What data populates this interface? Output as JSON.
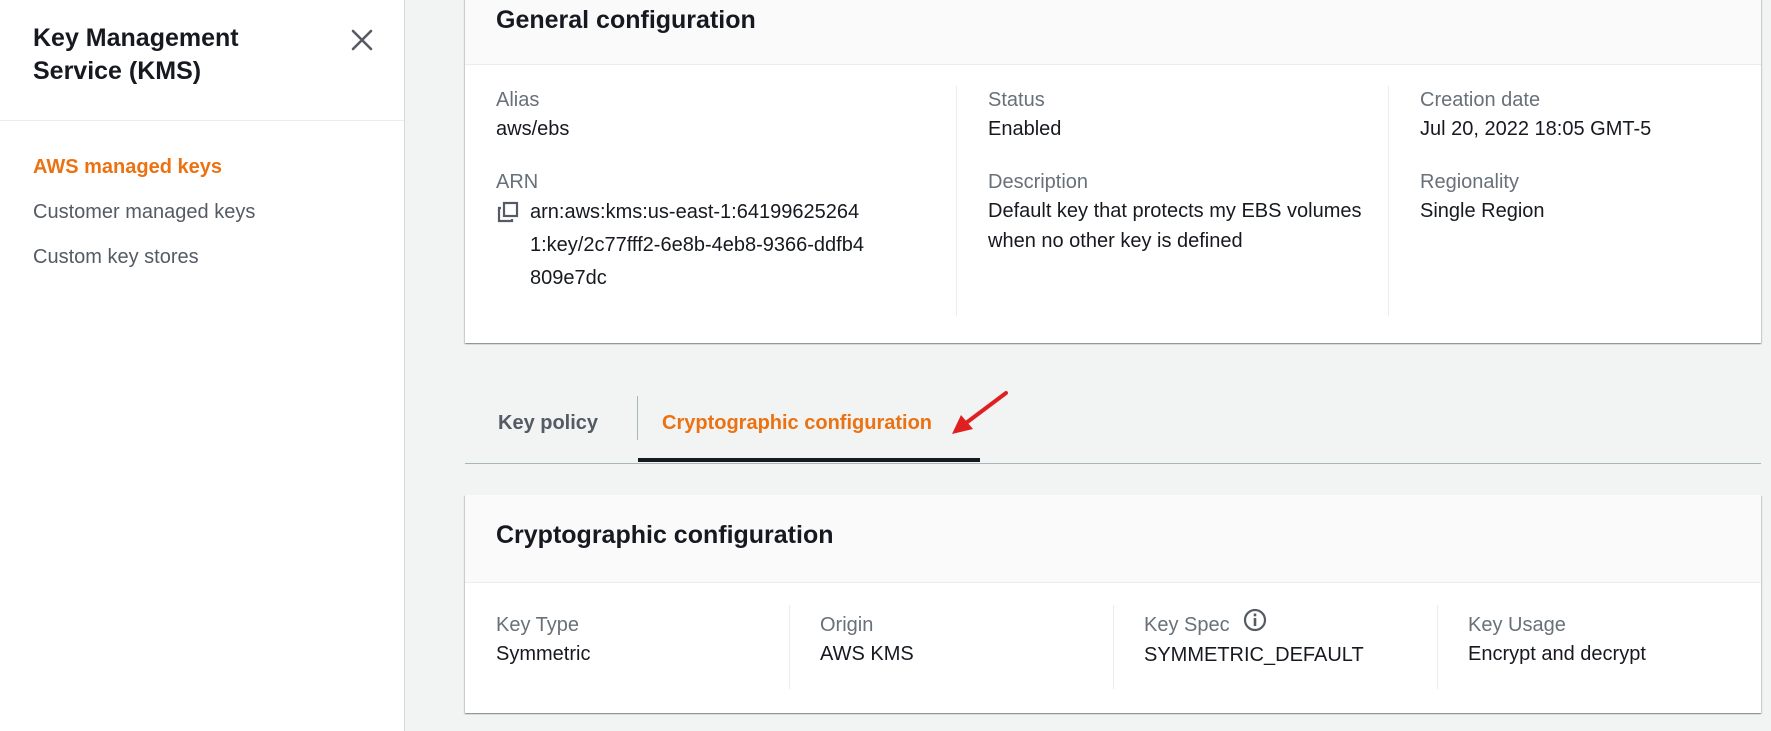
{
  "sidebar": {
    "title": "Key Management Service (KMS)",
    "items": [
      {
        "label": "AWS managed keys",
        "active": true
      },
      {
        "label": "Customer managed keys",
        "active": false
      },
      {
        "label": "Custom key stores",
        "active": false
      }
    ]
  },
  "general": {
    "title": "General configuration",
    "alias_label": "Alias",
    "alias_value": "aws/ebs",
    "arn_label": "ARN",
    "arn_value": "arn:aws:kms:us-east-1:641996252641:key/2c77fff2-6e8b-4eb8-9366-ddfb4809e7dc",
    "status_label": "Status",
    "status_value": "Enabled",
    "description_label": "Description",
    "description_value": "Default key that protects my EBS volumes when no other key is defined",
    "creation_label": "Creation date",
    "creation_value": "Jul 20, 2022 18:05 GMT-5",
    "regionality_label": "Regionality",
    "regionality_value": "Single Region"
  },
  "tabs": [
    {
      "label": "Key policy",
      "active": false
    },
    {
      "label": "Cryptographic configuration",
      "active": true
    }
  ],
  "crypto": {
    "title": "Cryptographic configuration",
    "key_type_label": "Key Type",
    "key_type_value": "Symmetric",
    "origin_label": "Origin",
    "origin_value": "AWS KMS",
    "key_spec_label": "Key Spec",
    "key_spec_value": "SYMMETRIC_DEFAULT",
    "key_usage_label": "Key Usage",
    "key_usage_value": "Encrypt and decrypt"
  },
  "colors": {
    "accent": "#ec7211",
    "text": "#16191f",
    "muted": "#687078",
    "annotation": "#e02020"
  },
  "icons": [
    "close-icon",
    "copy-icon",
    "info-icon",
    "annotation-arrow"
  ]
}
